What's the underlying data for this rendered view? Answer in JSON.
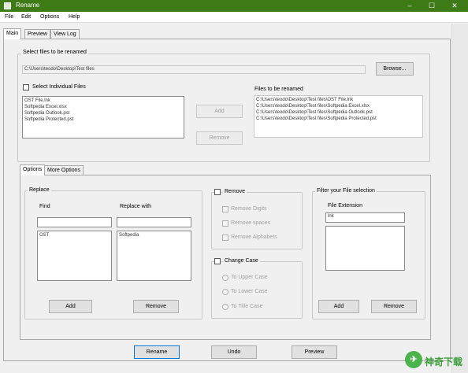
{
  "window": {
    "title": "Rename",
    "controls": [
      "–",
      "☐",
      "✕"
    ]
  },
  "menu": [
    "File",
    "Edit",
    "Options",
    "Help"
  ],
  "tabs": [
    "Main",
    "Preview",
    "View Log"
  ],
  "select_files": {
    "legend": "Select files to be renamed",
    "path": "C:\\Users\\teodo\\Desktop\\Test files",
    "browse_label": "Browse...",
    "select_individual_label": "Select Individual Files",
    "individual_files": [
      "OST File.lnk",
      "Softpedia Excel.xlsx",
      "Softpedia Outlook.pst",
      "Softpedia Protected.pst"
    ],
    "add_label": "Add",
    "remove_label": "Remove",
    "files_to_rename_label": "Files to be renamed",
    "files_to_rename": [
      "C:\\Users\\teodo\\Desktop\\Test files\\OST File.lnk",
      "C:\\Users\\teodo\\Desktop\\Test files\\Softpedia Excel.xlsx",
      "C:\\Users\\teodo\\Desktop\\Test files\\Softpedia Outlook.pst",
      "C:\\Users\\teodo\\Desktop\\Test files\\Softpedia Protected.pst"
    ]
  },
  "option_tabs": [
    "Options",
    "More Options"
  ],
  "replace": {
    "legend": "Replace",
    "find_label": "Find",
    "replace_with_label": "Replace with",
    "find_value": "",
    "replace_value": "",
    "find_items": [
      "OST"
    ],
    "replace_items": [
      "Softpedia"
    ],
    "add_label": "Add",
    "remove_label": "Remove"
  },
  "remove_group": {
    "legend": "Remove",
    "options": [
      "Remove Digits",
      "Remove spaces",
      "Remove Alphabets"
    ]
  },
  "change_case": {
    "legend": "Change Case",
    "options": [
      "To Upper Case",
      "To Lower Case",
      "To Title Case"
    ]
  },
  "filter": {
    "legend": "Filter your File selection",
    "extension_label": "File Extension",
    "extension_value": "lnk",
    "add_label": "Add",
    "remove_label": "Remove"
  },
  "footer": {
    "rename_label": "Rename",
    "undo_label": "Undo",
    "preview_label": "Preview"
  },
  "watermark": {
    "logo_char": "✈",
    "text": "神奇下载"
  }
}
